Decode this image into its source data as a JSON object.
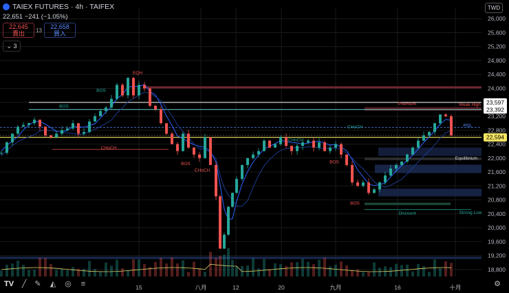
{
  "header": {
    "symbol": "TAIEX FUTURES · 4h · TAIFEX",
    "price_line": "22,651  −241 (−1.05%)",
    "sell_price": "22,645",
    "sell_label": "賣出",
    "spread": "13",
    "buy_price": "22,658",
    "buy_label": "買入",
    "indicator_count": "3",
    "currency": "TWD",
    "logo": "TV"
  },
  "colors": {
    "up": "#26a69a",
    "down": "#ef5350",
    "grid": "#1a1a1a",
    "current_price": "#f5e663",
    "premium": "#5a1e24",
    "discount": "#1b2a52"
  },
  "chart_data": {
    "type": "candlestick",
    "ylim": [
      18600,
      26300
    ],
    "y_ticks": [
      "26,000",
      "25,600",
      "25,200",
      "24,800",
      "24,400",
      "24,000",
      "23,600",
      "23,200",
      "22,800",
      "22,400",
      "22,000",
      "21,600",
      "21,200",
      "20,800",
      "20,400",
      "20,000",
      "19,600",
      "19,200",
      "18,800"
    ],
    "x_ticks": [
      "15",
      "八月",
      "12",
      "20",
      "九月",
      "16",
      "十月"
    ],
    "close_path": [
      [
        0,
        22150
      ],
      [
        8,
        22450
      ],
      [
        16,
        22700
      ],
      [
        24,
        22900
      ],
      [
        32,
        22950
      ],
      [
        40,
        23000
      ],
      [
        48,
        23100
      ],
      [
        56,
        22900
      ],
      [
        64,
        22650
      ],
      [
        72,
        22600
      ],
      [
        80,
        22700
      ],
      [
        88,
        22800
      ],
      [
        96,
        22850
      ],
      [
        104,
        23000
      ],
      [
        112,
        22700
      ],
      [
        120,
        22750
      ],
      [
        128,
        23050
      ],
      [
        136,
        23200
      ],
      [
        144,
        23350
      ],
      [
        152,
        23450
      ],
      [
        160,
        23700
      ],
      [
        168,
        24100
      ],
      [
        176,
        23800
      ],
      [
        184,
        24300
      ],
      [
        192,
        23800
      ],
      [
        200,
        24100
      ],
      [
        208,
        24000
      ],
      [
        216,
        23500
      ],
      [
        224,
        23400
      ],
      [
        232,
        23000
      ],
      [
        240,
        22700
      ],
      [
        248,
        22400
      ],
      [
        256,
        22200
      ],
      [
        264,
        22700
      ],
      [
        272,
        22300
      ],
      [
        280,
        22100
      ],
      [
        288,
        22000
      ],
      [
        296,
        22600
      ],
      [
        304,
        21800
      ],
      [
        312,
        20900
      ],
      [
        318,
        19400
      ],
      [
        324,
        19800
      ],
      [
        330,
        20600
      ],
      [
        336,
        21000
      ],
      [
        342,
        21400
      ],
      [
        350,
        21800
      ],
      [
        358,
        22000
      ],
      [
        366,
        22100
      ],
      [
        374,
        22200
      ],
      [
        382,
        22500
      ],
      [
        390,
        22300
      ],
      [
        398,
        22400
      ],
      [
        406,
        22600
      ],
      [
        414,
        22350
      ],
      [
        422,
        22200
      ],
      [
        430,
        22350
      ],
      [
        438,
        22450
      ],
      [
        446,
        22500
      ],
      [
        454,
        22300
      ],
      [
        462,
        22450
      ],
      [
        470,
        22200
      ],
      [
        478,
        22300
      ],
      [
        486,
        22400
      ],
      [
        494,
        22100
      ],
      [
        502,
        21800
      ],
      [
        510,
        21300
      ],
      [
        518,
        21200
      ],
      [
        526,
        21300
      ],
      [
        534,
        21000
      ],
      [
        542,
        21100
      ],
      [
        550,
        21300
      ],
      [
        558,
        21500
      ],
      [
        566,
        21700
      ],
      [
        574,
        21800
      ],
      [
        582,
        21900
      ],
      [
        590,
        22100
      ],
      [
        598,
        22300
      ],
      [
        606,
        22500
      ],
      [
        614,
        22650
      ],
      [
        622,
        22750
      ],
      [
        630,
        23000
      ],
      [
        638,
        23250
      ],
      [
        646,
        23200
      ],
      [
        654,
        22651
      ]
    ],
    "price_labels": [
      {
        "value": 23597,
        "text": "23,597",
        "style": "white"
      },
      {
        "value": 23392,
        "text": "23,392",
        "style": "white"
      },
      {
        "value": 22594,
        "text": "22,594",
        "style": "yellow"
      }
    ],
    "annotations": [
      {
        "text": "BOS",
        "x": 93,
        "y": 23450,
        "color": "#26a69a"
      },
      {
        "text": "CHoCH",
        "x": 158,
        "y": 22250,
        "color": "#ef5350"
      },
      {
        "text": "CHoCH",
        "x": 516,
        "y": 22850,
        "color": "#26a69a"
      },
      {
        "text": "Premium",
        "x": 592,
        "y": 23520,
        "color": "#ef5350"
      },
      {
        "text": "Weak High",
        "x": 683,
        "y": 23500,
        "color": "#ef5350"
      },
      {
        "text": "PDL",
        "x": 680,
        "y": 22890,
        "color": "#5b8cff"
      },
      {
        "text": "Equilibrium",
        "x": 678,
        "y": 21960,
        "color": "#d1d4dc"
      },
      {
        "text": "Discount",
        "x": 592,
        "y": 20380,
        "color": "#26a69a"
      },
      {
        "text": "Strong Low",
        "x": 684,
        "y": 20400,
        "color": "#26a69a"
      },
      {
        "text": "BOS",
        "x": 516,
        "y": 20660,
        "color": "#ef5350"
      },
      {
        "text": "EQH",
        "x": 200,
        "y": 24400,
        "color": "#ef5350"
      },
      {
        "text": "BOS",
        "x": 147,
        "y": 23900,
        "color": "#26a69a"
      },
      {
        "text": "BOS",
        "x": 270,
        "y": 21800,
        "color": "#ef5350"
      },
      {
        "text": "CHoCH",
        "x": 294,
        "y": 21610,
        "color": "#ef5350"
      },
      {
        "text": "CHoCH",
        "x": 430,
        "y": 22480,
        "color": "#26a69a"
      },
      {
        "text": "BOS",
        "x": 486,
        "y": 21850,
        "color": "#ef5350"
      }
    ]
  }
}
